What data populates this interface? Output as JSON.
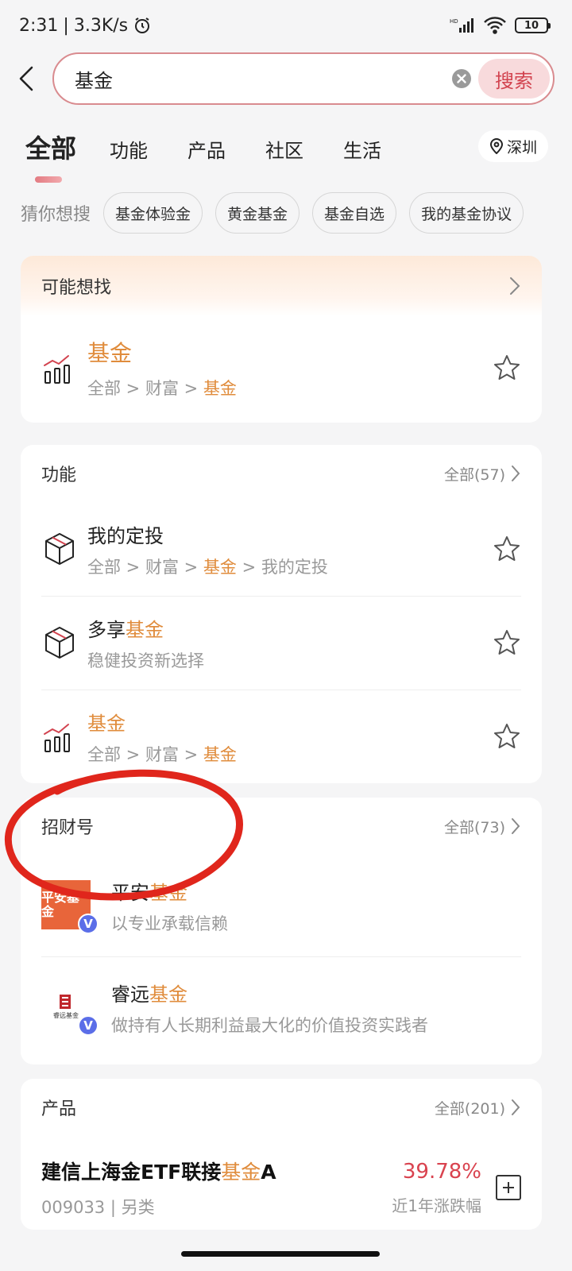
{
  "status_bar": {
    "time": "2:31",
    "speed": "3.3K/s",
    "battery": "10"
  },
  "search": {
    "value": "基金",
    "button_label": "搜索"
  },
  "tabs": [
    {
      "label": "全部"
    },
    {
      "label": "功能"
    },
    {
      "label": "产品"
    },
    {
      "label": "社区"
    },
    {
      "label": "生活"
    }
  ],
  "location": "深圳",
  "suggestions": {
    "label": "猜你想搜",
    "chips": [
      "基金体验金",
      "黄金基金",
      "基金自选",
      "我的基金协议"
    ]
  },
  "favorite_card": {
    "header": "可能想找",
    "item": {
      "title": "基金",
      "path_prefix": "全部 > 财富 > ",
      "path_highlight": "基金"
    }
  },
  "function_card": {
    "header": "功能",
    "all_label": "全部(57)",
    "items": [
      {
        "title_plain": "我的定投",
        "title_hl": "",
        "sub_pre": "全部 > 财富 > ",
        "sub_hl": "基金",
        "sub_post": " > 我的定投"
      },
      {
        "title_plain": "多享",
        "title_hl": "基金",
        "sub_pre": "稳健投资新选择",
        "sub_hl": "",
        "sub_post": ""
      },
      {
        "title_plain": "",
        "title_hl": "基金",
        "sub_pre": "全部 > 财富 > ",
        "sub_hl": "基金",
        "sub_post": ""
      }
    ]
  },
  "account_card": {
    "header": "招财号",
    "all_label": "全部(73)",
    "items": [
      {
        "title_plain": "平安",
        "title_hl": "基金",
        "sub": "以专业承载信赖",
        "avatar_text": "平安基金"
      },
      {
        "title_plain": "睿远",
        "title_hl": "基金",
        "sub": "做持有人长期利益最大化的价值投资实践者",
        "avatar_text": "睿远基金"
      }
    ]
  },
  "product_card": {
    "header": "产品",
    "all_label": "全部(201)",
    "item": {
      "title_plain": "建信上海金ETF联接",
      "title_hl": "基金",
      "title_suffix": "A",
      "sub": "009033 | 另类",
      "rate": "39.78%",
      "rate_label": "近1年涨跌幅"
    }
  },
  "colors": {
    "accent": "#d2434f",
    "highlight": "#e08c3c",
    "annotation": "#e0261c"
  }
}
